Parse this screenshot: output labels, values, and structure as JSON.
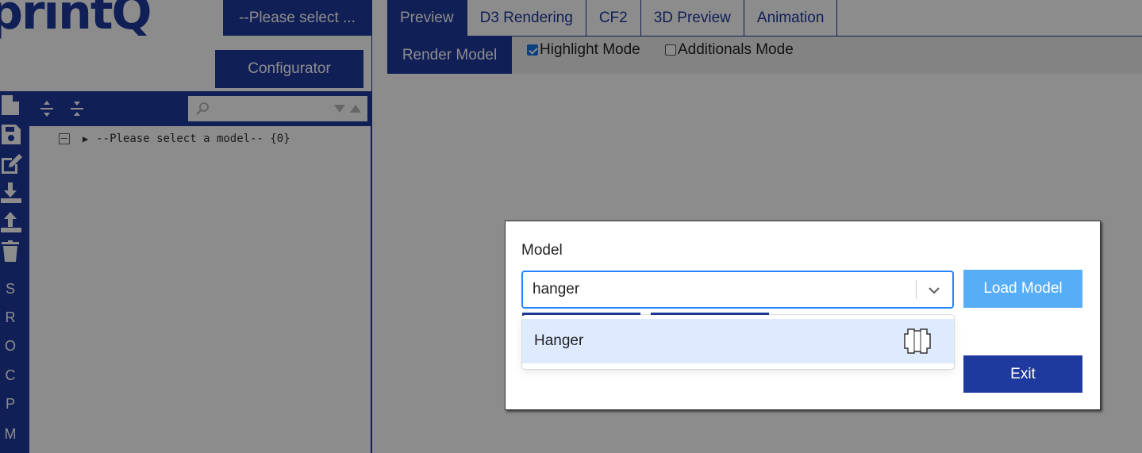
{
  "app": {
    "logo_text": "printQ"
  },
  "sidebar": {
    "model_select_label": "--Please select ...",
    "configurator_label": "Configurator",
    "tree": {
      "root_label": "--Please select a model-- {0}"
    },
    "side_letters": [
      "S",
      "R",
      "O",
      "C",
      "P",
      "M"
    ]
  },
  "tabs": [
    {
      "label": "Preview",
      "active": true
    },
    {
      "label": "D3 Rendering",
      "active": false
    },
    {
      "label": "CF2",
      "active": false
    },
    {
      "label": "3D Preview",
      "active": false
    },
    {
      "label": "Animation",
      "active": false
    }
  ],
  "toolbar": {
    "render_label": "Render Model",
    "highlight_label": "Highlight Mode",
    "highlight_checked": true,
    "additionals_label": "Additionals Mode",
    "additionals_checked": false
  },
  "modal": {
    "label": "Model",
    "input_value": "hanger",
    "load_label": "Load Model",
    "exit_label": "Exit",
    "options": [
      {
        "label": "Hanger",
        "thumb_icon": "hanger-outline-icon"
      }
    ]
  },
  "colors": {
    "brand": "#1f3a9e",
    "load_button": "#58adf7",
    "focus_border": "#2684ff",
    "option_highlight": "#deebff"
  }
}
